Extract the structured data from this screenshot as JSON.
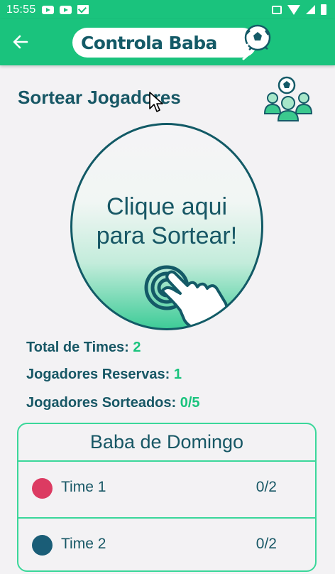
{
  "status_bar": {
    "time": "15:55",
    "notifications": [
      "youtube-icon",
      "youtube-icon",
      "gmail-icon"
    ],
    "system_icons": [
      "vibrate-icon",
      "wifi-icon",
      "signal-icon",
      "battery-icon"
    ]
  },
  "app_bar": {
    "back_icon": "arrow-left-icon",
    "logo_text": "Controla Baba",
    "logo_icon": "soccer-ball-icon",
    "background": "#1ac37d"
  },
  "page": {
    "title": "Sortear Jogadores",
    "title_icon": "players-group-icon"
  },
  "draw_button": {
    "line1": "Clique aqui",
    "line2": "para Sortear!",
    "icon": "tap-hand-icon"
  },
  "stats": {
    "total_times_label": "Total de Times:",
    "total_times_value": "2",
    "reservas_label": "Jogadores Reservas:",
    "reservas_value": "1",
    "sorteados_label": "Jogadores Sorteados:",
    "sorteados_value": "0/5"
  },
  "baba": {
    "title": "Baba de Domingo",
    "teams": [
      {
        "name": "Time 1",
        "count": "0/2",
        "color": "#dc3b62"
      },
      {
        "name": "Time 2",
        "count": "0/2",
        "color": "#1a5d77"
      }
    ]
  },
  "colors": {
    "primary": "#1ac37d",
    "dark_teal": "#175765",
    "accent_border": "#3ad79a"
  }
}
